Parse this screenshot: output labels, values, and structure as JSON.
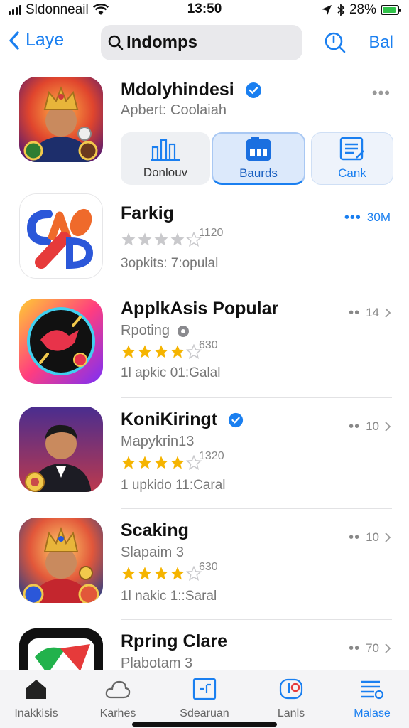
{
  "status_bar": {
    "carrier": "Sldonneail",
    "time": "13:50",
    "battery": "28%",
    "battery_level": 0.9,
    "icons": [
      "signal-icon",
      "wifi-icon",
      "location-icon",
      "bluetooth-icon",
      "battery-icon"
    ]
  },
  "nav": {
    "back_label": "Laye",
    "search_value": "Indomps",
    "right_label": "Bal"
  },
  "featured": {
    "name": "Mdolyhindesi",
    "subtitle": "Apbert: Coolaiah",
    "more": "•••",
    "actions": [
      {
        "label": "Donlouv",
        "icon": "chart-icon"
      },
      {
        "label": "Baurds",
        "icon": "board-icon"
      },
      {
        "label": "Cank",
        "icon": "document-icon"
      }
    ]
  },
  "apps": [
    {
      "name": "Farkig",
      "subtitle": "",
      "rating_count": "1120",
      "meta": "3opkits: 7:opulal",
      "right": "•••",
      "right_value": "30M",
      "stars": 4,
      "verified": false,
      "star_color": "#c9c9cc"
    },
    {
      "name": "ApplkAsis Popular",
      "subtitle": "Rpoting",
      "rating_count": "630",
      "meta": "1l apkic 01:Galal",
      "right": "••",
      "right_value": "14",
      "stars": 4,
      "verified": false,
      "star_color": "#f5b400"
    },
    {
      "name": "KoniKiringt",
      "subtitle": "Mapykrin13",
      "rating_count": "1320",
      "meta": "1 upkido 11:Caral",
      "right": "••",
      "right_value": "10",
      "stars": 4,
      "verified": true,
      "star_color": "#f5b400"
    },
    {
      "name": "Scaking",
      "subtitle": "Slapaim 3",
      "rating_count": "630",
      "meta": "1l nakic 1::Saral",
      "right": "••",
      "right_value": "10",
      "stars": 4,
      "verified": false,
      "star_color": "#f5b400"
    },
    {
      "name": "Rpring Clare",
      "subtitle": "Plabotam 3",
      "rating_count": "",
      "meta": "",
      "right": "••",
      "right_value": "70",
      "stars": 0,
      "verified": false,
      "star_color": "#f5b400"
    }
  ],
  "tabs": [
    {
      "label": "Inakkisis",
      "icon": "home-icon",
      "active": false
    },
    {
      "label": "Karhes",
      "icon": "cloud-icon",
      "active": false
    },
    {
      "label": "Sdearuan",
      "icon": "frame-icon",
      "active": false
    },
    {
      "label": "Lanls",
      "icon": "apps-icon",
      "active": false
    },
    {
      "label": "Malase",
      "icon": "list-icon",
      "active": true
    }
  ],
  "colors": {
    "accent": "#1a7ff0",
    "star": "#f5b400",
    "verified": "#1a7ff0"
  }
}
